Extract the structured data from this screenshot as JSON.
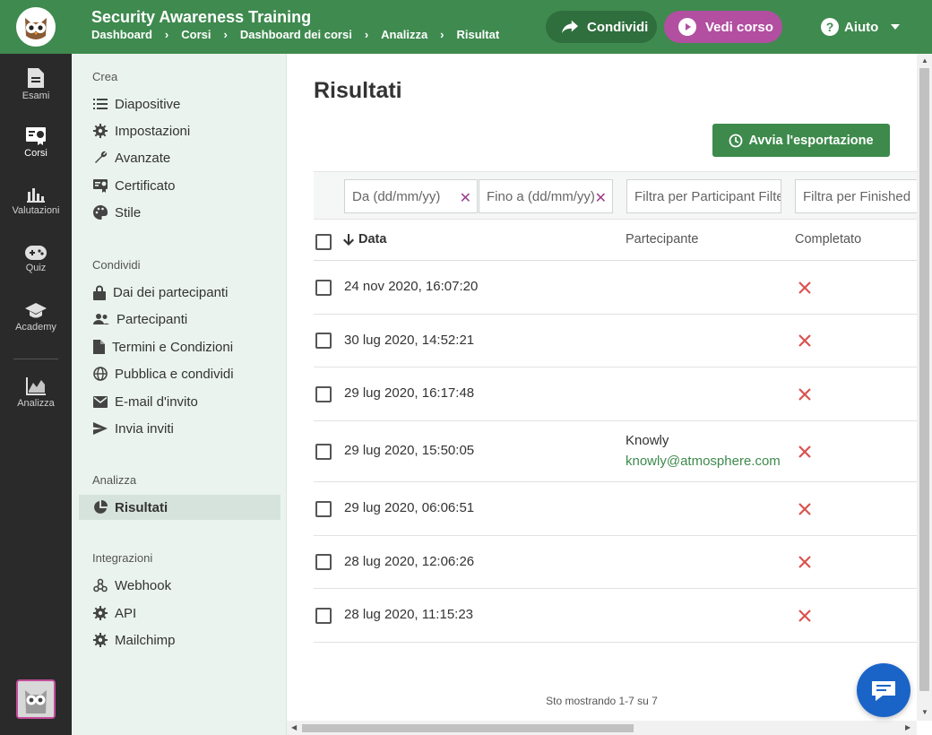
{
  "app": {
    "title": "Security Awareness Training"
  },
  "breadcrumbs": [
    "Dashboard",
    "Corsi",
    "Dashboard dei corsi",
    "Analizza",
    "Risultat"
  ],
  "topbar": {
    "share_label": "Condividi",
    "view_label": "Vedi corso",
    "help_label": "Aiuto"
  },
  "rail": [
    {
      "label": "Esami",
      "icon": "document-icon"
    },
    {
      "label": "Corsi",
      "icon": "course-icon",
      "active": true
    },
    {
      "label": "Valutazioni",
      "icon": "bar-chart-icon"
    },
    {
      "label": "Quiz",
      "icon": "gamepad-icon"
    },
    {
      "label": "Academy",
      "icon": "graduation-cap-icon"
    },
    {
      "label": "Analizza",
      "icon": "line-chart-icon"
    }
  ],
  "sidebar": {
    "sections": [
      {
        "title": "Crea",
        "items": [
          {
            "label": "Diapositive",
            "icon": "list-icon"
          },
          {
            "label": "Impostazioni",
            "icon": "gear-icon"
          },
          {
            "label": "Avanzate",
            "icon": "wrench-icon"
          },
          {
            "label": "Certificato",
            "icon": "certificate-icon"
          },
          {
            "label": "Stile",
            "icon": "palette-icon"
          }
        ]
      },
      {
        "title": "Condividi",
        "items": [
          {
            "label": "Dai dei partecipanti",
            "icon": "lock-icon"
          },
          {
            "label": "Partecipanti",
            "icon": "people-icon"
          },
          {
            "label": "Termini e Condizioni",
            "icon": "file-icon"
          },
          {
            "label": "Pubblica e condividi",
            "icon": "globe-icon"
          },
          {
            "label": "E-mail d'invito",
            "icon": "mail-icon"
          },
          {
            "label": "Invia inviti",
            "icon": "send-icon"
          }
        ]
      },
      {
        "title": "Analizza",
        "items": [
          {
            "label": "Risultati",
            "icon": "pie-chart-icon",
            "active": true
          }
        ]
      },
      {
        "title": "Integrazioni",
        "items": [
          {
            "label": "Webhook",
            "icon": "webhook-icon"
          },
          {
            "label": "API",
            "icon": "gear-icon"
          },
          {
            "label": "Mailchimp",
            "icon": "gear-icon"
          }
        ]
      }
    ]
  },
  "main": {
    "title": "Risultati",
    "export_label": "Avvia l'esportazione",
    "filters": {
      "from_placeholder": "Da (dd/mm/yy)",
      "to_placeholder": "Fino a (dd/mm/yy)",
      "participant_placeholder": "Filtra per Participant Filter",
      "finished_placeholder": "Filtra per Finished"
    },
    "columns": {
      "date": "Data",
      "participant": "Partecipante",
      "completed": "Completato"
    },
    "rows": [
      {
        "date": "24 nov 2020, 16:07:20",
        "participant_name": "",
        "participant_email": "",
        "completed": false
      },
      {
        "date": "30 lug 2020, 14:52:21",
        "participant_name": "",
        "participant_email": "",
        "completed": false
      },
      {
        "date": "29 lug 2020, 16:17:48",
        "participant_name": "",
        "participant_email": "",
        "completed": false
      },
      {
        "date": "29 lug 2020, 15:50:05",
        "participant_name": "Knowly",
        "participant_email": "knowly@atmosphere.com",
        "completed": false
      },
      {
        "date": "29 lug 2020, 06:06:51",
        "participant_name": "",
        "participant_email": "",
        "completed": false
      },
      {
        "date": "28 lug 2020, 12:06:26",
        "participant_name": "",
        "participant_email": "",
        "completed": false
      },
      {
        "date": "28 lug 2020, 11:15:23",
        "participant_name": "",
        "participant_email": "",
        "completed": false
      }
    ],
    "footer": "Sto mostrando 1-7 su 7"
  },
  "colors": {
    "brand_green": "#3f8a4f",
    "accent_purple": "#b24fa0",
    "error_red": "#d9534f",
    "link_green": "#3d8a4c"
  }
}
